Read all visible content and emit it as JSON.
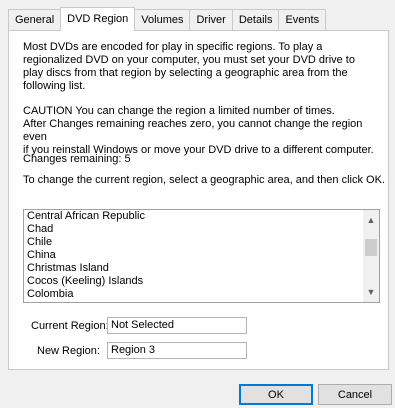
{
  "tabs": [
    {
      "label": "General",
      "active": false
    },
    {
      "label": "DVD Region",
      "active": true
    },
    {
      "label": "Volumes",
      "active": false
    },
    {
      "label": "Driver",
      "active": false
    },
    {
      "label": "Details",
      "active": false
    },
    {
      "label": "Events",
      "active": false
    }
  ],
  "content": {
    "intro_lines": [
      "Most DVDs are encoded for play in specific regions. To play a",
      "regionalized DVD on your computer, you must set your DVD drive to",
      "play discs from that region by selecting a geographic area from the",
      "following list."
    ],
    "caution_lines": [
      "CAUTION  You can change the region a limited number of times.",
      "After Changes remaining reaches zero, you cannot change the region even",
      "if you reinstall Windows or move your DVD drive to a different computer."
    ],
    "changes_remaining": "Changes remaining: 5",
    "instruction": "To change the current region, select a geographic area, and then click OK."
  },
  "region_list": {
    "items": [
      "Central African Republic",
      "Chad",
      "Chile",
      "China",
      "Christmas Island",
      "Cocos (Keeling) Islands",
      "Colombia"
    ],
    "scroll_up_icon": "▲",
    "scroll_down_icon": "▼"
  },
  "current_region": {
    "label": "Current Region:",
    "value": "Not Selected"
  },
  "new_region": {
    "label": "New Region:",
    "value": "Region 3"
  },
  "buttons": {
    "ok": "OK",
    "cancel": "Cancel"
  },
  "colors": {
    "accent": "#0078d7",
    "panel": "#ffffff",
    "window": "#f0f0f0"
  }
}
